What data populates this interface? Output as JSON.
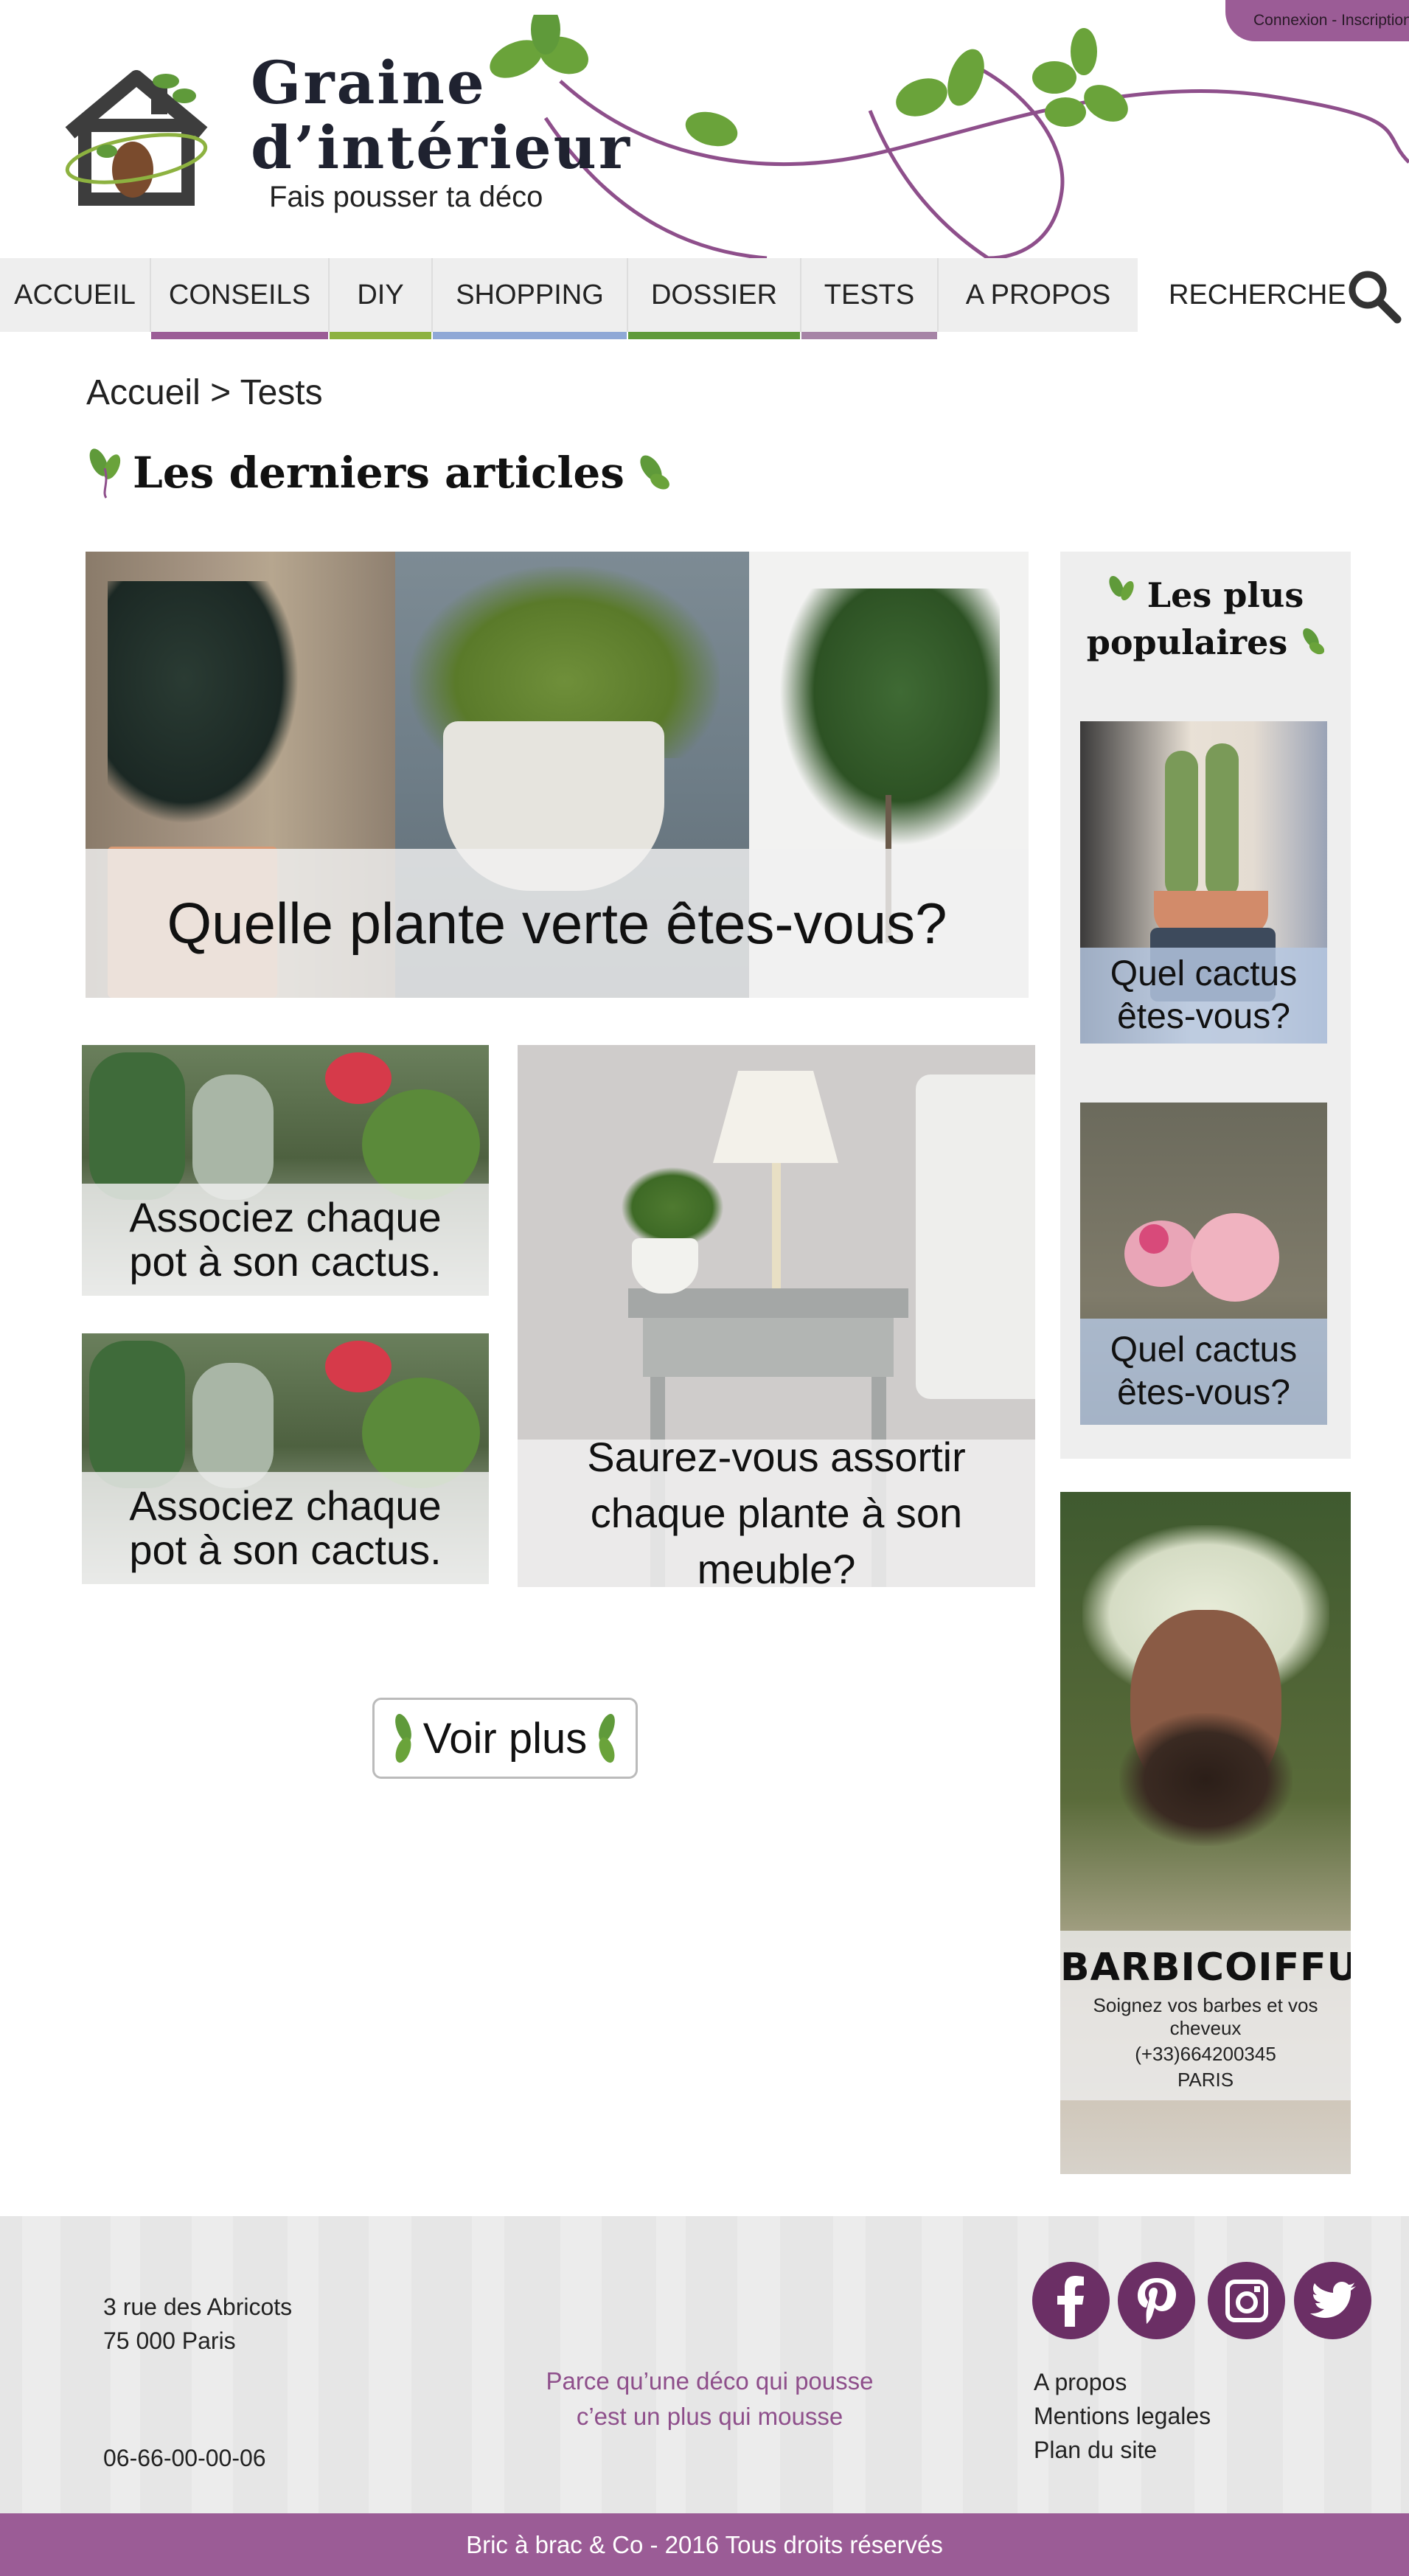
{
  "header": {
    "login_label": "Connexion - Inscription",
    "brand_line1": "Graine",
    "brand_line2": "d’intérieur",
    "tagline": "Fais pousser ta déco"
  },
  "nav": {
    "items": [
      {
        "label": "ACCUEIL",
        "accent": ""
      },
      {
        "label": "CONSEILS",
        "accent": "#9b5c96"
      },
      {
        "label": "DIY",
        "accent": "#8db240"
      },
      {
        "label": "SHOPPING",
        "accent": "#8fa8d6"
      },
      {
        "label": "DOSSIER",
        "accent": "#5f9a3a"
      },
      {
        "label": "TESTS",
        "accent": "#a684a6"
      },
      {
        "label": "A PROPOS",
        "accent": ""
      }
    ],
    "search_label": "RECHERCHE"
  },
  "breadcrumb": "Accueil > Tests",
  "latest": {
    "title": "Les derniers articles",
    "hero_caption": "Quelle plante verte êtes-vous?",
    "card1_caption": "Associez chaque pot à son cactus.",
    "card2_caption": "Associez chaque pot à son cactus.",
    "card3_caption": "Saurez-vous assortir chaque plante à son meuble?",
    "more_label": "Voir plus"
  },
  "popular": {
    "title_line1": "Les plus",
    "title_line2": "populaires",
    "items": [
      {
        "caption": "Quel cactus êtes-vous?"
      },
      {
        "caption": "Quel cactus êtes-vous?"
      }
    ]
  },
  "ad": {
    "brand": "BARBICOIFFURE",
    "line1": "Soignez vos barbes et vos cheveux",
    "phone": "(+33)664200345",
    "city": "PARIS"
  },
  "footer": {
    "address1": "3 rue des Abricots",
    "address2": "75 000 Paris",
    "phone": "06-66-00-00-06",
    "slogan1": "Parce qu’une déco qui pousse",
    "slogan2": "c’est un plus qui mousse",
    "links": [
      "A propos",
      "Mentions legales",
      "Plan du site"
    ],
    "copyright": "Bric à brac & Co - 2016 Tous droits réservés"
  },
  "social_icons": [
    "facebook-icon",
    "pinterest-icon",
    "instagram-icon",
    "twitter-icon"
  ],
  "colors": {
    "brand_purple": "#9b5c96",
    "dark_purple": "#6b2f65",
    "leaf_green": "#5f9a3a",
    "nav_bg": "#eeeeee"
  }
}
